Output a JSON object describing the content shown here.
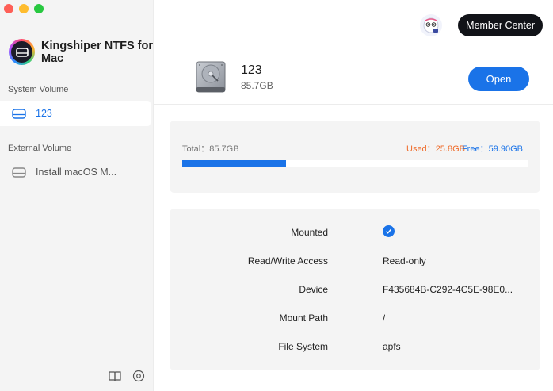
{
  "app": {
    "name": "Kingshiper NTFS for Mac"
  },
  "sidebar": {
    "system_label": "System Volume",
    "system_items": [
      {
        "label": "123"
      }
    ],
    "external_label": "External Volume",
    "external_items": [
      {
        "label": "Install macOS M..."
      }
    ]
  },
  "header": {
    "member_label": "Member Center"
  },
  "disk": {
    "name": "123",
    "size": "85.7GB",
    "open_label": "Open"
  },
  "usage": {
    "total_text": "Total：85.7GB",
    "used_label": "Used：",
    "used_value": "25.8GB",
    "free_label": "Free：",
    "free_value": "59.90GB",
    "used_fraction": 0.3,
    "used_color": "#ef6c2b",
    "free_color": "#1a73e8"
  },
  "info": [
    {
      "label": "Mounted",
      "value": "",
      "icon": "check-circle-icon"
    },
    {
      "label": "Read/Write Access",
      "value": "Read-only"
    },
    {
      "label": "Device",
      "value": "F435684B-C292-4C5E-98E0..."
    },
    {
      "label": "Mount Path",
      "value": "/"
    },
    {
      "label": "File System",
      "value": "apfs"
    }
  ],
  "colors": {
    "accent": "#1a73e8"
  }
}
